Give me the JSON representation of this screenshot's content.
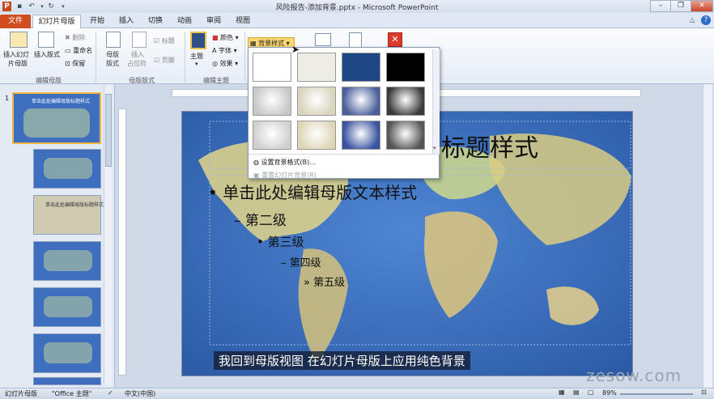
{
  "title": "风险报告-添加背景.pptx - Microsoft PowerPoint",
  "tabs": [
    "文件",
    "幻灯片母版",
    "开始",
    "插入",
    "切换",
    "动画",
    "审阅",
    "视图"
  ],
  "ribbon": {
    "insert_master": [
      "插入幻灯",
      "片母版"
    ],
    "insert_layout": "插入版式",
    "delete": "删除",
    "rename": "重命名",
    "preserve": "保留",
    "master_layout": [
      "母版",
      "版式"
    ],
    "insert_placeholder": [
      "插入",
      "占位符"
    ],
    "title_check": "标题",
    "footer_check": "页脚",
    "themes": "主题",
    "colors": "颜色",
    "fonts": "字体",
    "effects": "效果",
    "bg_styles": "背景样式",
    "groups": [
      "编辑母版",
      "母版版式",
      "编辑主题"
    ]
  },
  "gallery": {
    "format_bg": "设置背景格式(B)...",
    "reset_bg": "重置幻灯片背景(R)",
    "swatches": [
      [
        "#ffffff",
        "#eeede5",
        "#1f4785",
        "#000000"
      ],
      [
        "#c8c8c8",
        "#d8d4bd",
        "#4a5f9a",
        "#3a3a3a"
      ],
      [
        "#d0d0d0",
        "#ddd6b6",
        "#3a53a0",
        "#555555"
      ]
    ]
  },
  "slide": {
    "title": "单击此处编辑母版标题样式",
    "level1": "单击此处编辑母版文本样式",
    "level2": "第二级",
    "level3": "第三级",
    "level4": "第四级",
    "level5": "第五级",
    "thumb_title": "单击此处编辑母版标题样式"
  },
  "subtitle": "我回到母版视图 在幻灯片母版上应用纯色背景",
  "watermark": "zesow.com",
  "status": {
    "view": "幻灯片母版",
    "theme": "\"Office 主题\"",
    "lang": "中文(中国)",
    "zoom": "89%"
  },
  "slide_number": "1"
}
